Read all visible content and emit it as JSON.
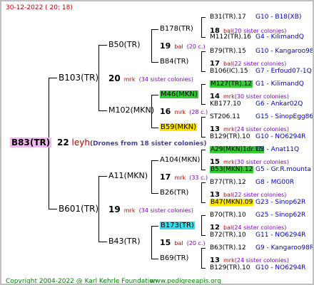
{
  "date": "30-12-2022 ( 20: 18)",
  "root": {
    "label": "B83(TR)",
    "num": "22",
    "abbr": "leyh",
    "desc": "(Drones from 18 sister colonies)"
  },
  "gen1": [
    {
      "label": "B103(TR)",
      "num": "20",
      "abbr": "mrk",
      "desc": "(34 sister colonies)"
    },
    {
      "label": "B601(TR)",
      "num": "19",
      "abbr": "mrk",
      "desc": "(34 sister colonies)"
    }
  ],
  "gen2": [
    {
      "label": "B50(TR)",
      "num": "19",
      "abbr": "bal",
      "desc": "(20 c.)"
    },
    {
      "label": "M102(MKN)",
      "num": "16",
      "abbr": "mrk",
      "desc": "(28 c.)"
    },
    {
      "label": "A11(MKN)",
      "num": "17",
      "abbr": "mrk",
      "desc": "(33 c.)"
    },
    {
      "label": "B43(TR)",
      "num": "15",
      "abbr": "bal",
      "desc": "(20 c.)"
    }
  ],
  "gen3": [
    {
      "label": "B178(TR)",
      "num": "18",
      "abbr": "bal",
      "desc": "(20 sister colonies)"
    },
    {
      "label": "B84(TR)",
      "num": "17",
      "abbr": "bal",
      "desc": "(22 sister colonies)"
    },
    {
      "label": "M46(MKN)",
      "num": "14",
      "abbr": "mrk",
      "desc": "(30 sister colonies)"
    },
    {
      "label": "B59(MKN)",
      "num": "13",
      "abbr": "mrk",
      "desc": "(24 sister colonies)"
    },
    {
      "label": "A104(MKN)",
      "num": "15",
      "abbr": "mrk",
      "desc": "(30 sister colonies)"
    },
    {
      "label": "B26(TR)",
      "num": "13",
      "abbr": "bal",
      "desc": "(22 sister colonies)"
    },
    {
      "label": "B173(TR)",
      "num": "12",
      "abbr": "bal",
      "desc": "(24 sister colonies)"
    },
    {
      "label": "B69(TR)",
      "num": "13",
      "abbr": "mrk",
      "desc": "(24 sister colonies)"
    }
  ],
  "gen4": [
    {
      "name": "B31(TR).17",
      "code": "G10 - B18(XB)"
    },
    {
      "name": "M112(TR).16",
      "code": "G4 - KilimandQ"
    },
    {
      "name": "B79(TR).15",
      "code": "G10 - Kangaroo98R"
    },
    {
      "name": "B106(IC).15",
      "code": "G7 - Erfoud07-1Q"
    },
    {
      "name": "M127(TR).12",
      "code": "G1 - KilimandQ"
    },
    {
      "name": "KB177.10",
      "code": "G6 - Ankar02Q"
    },
    {
      "name": "ST206.11",
      "code": "G15 - SinopEgg86R"
    },
    {
      "name": "B129(TR).10",
      "code": "G10 - NO6294R"
    },
    {
      "name": "A29(MKN)1dr.15",
      "code": "G3 - Anat11Q"
    },
    {
      "name": "B53(MKN).12",
      "code": "G5 - Gr.R.mounta"
    },
    {
      "name": "B77(TR).12",
      "code": "G8 - MG00R"
    },
    {
      "name": "B47(MKN).09",
      "code": "G23 - Sinop62R"
    },
    {
      "name": "B70(TR).10",
      "code": "G25 - Sinop62R"
    },
    {
      "name": "B72(TR).10",
      "code": "G11 - NO6294R"
    },
    {
      "name": "B63(TR).12",
      "code": "G9 - Kangaroo98R"
    },
    {
      "name": "B129(TR).10",
      "code": "G10 - NO6294R"
    }
  ],
  "footer": {
    "copyright": "Copyright 2004-2022 @ Karl Kehrle Foundation",
    "site": "www.pedigreeapis.org"
  },
  "colors": {
    "root_bg": "#f0b8f0",
    "green": "#33cc33",
    "yellow": "#ffe400",
    "cyan": "#33ddee",
    "red": "#c00000",
    "purple": "#8000c0",
    "blue": "#0000c0"
  }
}
